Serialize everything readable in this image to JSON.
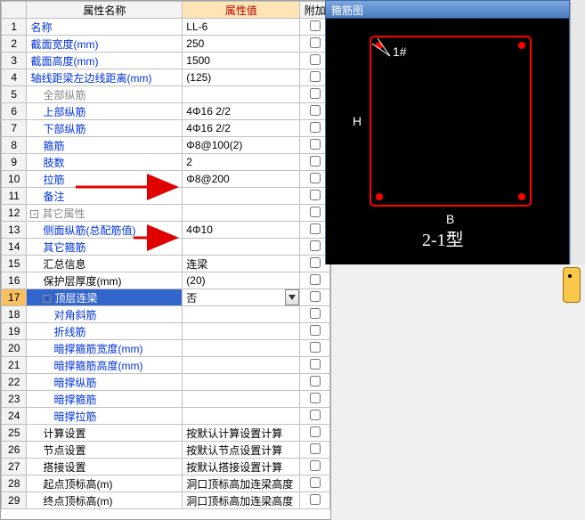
{
  "headers": {
    "name": "属性名称",
    "value": "属性值",
    "attach": "附加",
    "diagram_title": "箍筋图"
  },
  "diagram": {
    "label_1": "1#",
    "label_h": "H",
    "label_b": "B",
    "label_type": "2-1型"
  },
  "rows": [
    {
      "num": "1",
      "name": "名称",
      "val": "LL-6",
      "cls": "blue",
      "chk": false,
      "indent": 0
    },
    {
      "num": "2",
      "name": "截面宽度(mm)",
      "val": "250",
      "cls": "blue",
      "chk": true,
      "indent": 0
    },
    {
      "num": "3",
      "name": "截面高度(mm)",
      "val": "1500",
      "cls": "blue",
      "chk": true,
      "indent": 0
    },
    {
      "num": "4",
      "name": "轴线距梁左边线距离(mm)",
      "val": "(125)",
      "cls": "blue",
      "chk": true,
      "indent": 0
    },
    {
      "num": "5",
      "name": "全部纵筋",
      "val": "",
      "cls": "gray",
      "chk": true,
      "indent": 1
    },
    {
      "num": "6",
      "name": "上部纵筋",
      "val": "4Φ16 2/2",
      "cls": "blue",
      "chk": true,
      "indent": 1
    },
    {
      "num": "7",
      "name": "下部纵筋",
      "val": "4Φ16 2/2",
      "cls": "blue",
      "chk": true,
      "indent": 1
    },
    {
      "num": "8",
      "name": "箍筋",
      "val": "Φ8@100(2)",
      "cls": "blue",
      "chk": true,
      "indent": 1
    },
    {
      "num": "9",
      "name": "肢数",
      "val": "2",
      "cls": "blue",
      "chk": true,
      "indent": 1
    },
    {
      "num": "10",
      "name": "拉筋",
      "val": "Φ8@200",
      "cls": "blue",
      "chk": true,
      "indent": 1,
      "arrow": true
    },
    {
      "num": "11",
      "name": "备注",
      "val": "",
      "cls": "blue",
      "chk": true,
      "indent": 1
    },
    {
      "num": "12",
      "name": "其它属性",
      "val": "",
      "cls": "gray",
      "chk": false,
      "indent": 0,
      "toggle": "-"
    },
    {
      "num": "13",
      "name": "侧面纵筋(总配筋值)",
      "val": "4Φ10",
      "cls": "blue",
      "chk": true,
      "indent": 1,
      "arrow": true
    },
    {
      "num": "14",
      "name": "其它箍筋",
      "val": "",
      "cls": "blue",
      "chk": false,
      "indent": 1
    },
    {
      "num": "15",
      "name": "汇总信息",
      "val": "连梁",
      "cls": "",
      "chk": true,
      "indent": 1
    },
    {
      "num": "16",
      "name": "保护层厚度(mm)",
      "val": "(20)",
      "cls": "",
      "chk": true,
      "indent": 1
    },
    {
      "num": "17",
      "name": "顶层连梁",
      "val": "否",
      "cls": "",
      "chk": true,
      "indent": 1,
      "toggle": "-",
      "sel": true,
      "dd": true
    },
    {
      "num": "18",
      "name": "对角斜筋",
      "val": "",
      "cls": "blue",
      "chk": true,
      "indent": 2
    },
    {
      "num": "19",
      "name": "折线筋",
      "val": "",
      "cls": "blue",
      "chk": true,
      "indent": 2
    },
    {
      "num": "20",
      "name": "暗撑箍筋宽度(mm)",
      "val": "",
      "cls": "blue",
      "chk": true,
      "indent": 2
    },
    {
      "num": "21",
      "name": "暗撑箍筋高度(mm)",
      "val": "",
      "cls": "blue",
      "chk": true,
      "indent": 2
    },
    {
      "num": "22",
      "name": "暗撑纵筋",
      "val": "",
      "cls": "blue",
      "chk": true,
      "indent": 2
    },
    {
      "num": "23",
      "name": "暗撑箍筋",
      "val": "",
      "cls": "blue",
      "chk": true,
      "indent": 2
    },
    {
      "num": "24",
      "name": "暗撑拉筋",
      "val": "",
      "cls": "blue",
      "chk": true,
      "indent": 2
    },
    {
      "num": "25",
      "name": "计算设置",
      "val": "按默认计算设置计算",
      "cls": "",
      "chk": false,
      "indent": 1
    },
    {
      "num": "26",
      "name": "节点设置",
      "val": "按默认节点设置计算",
      "cls": "",
      "chk": false,
      "indent": 1
    },
    {
      "num": "27",
      "name": "搭接设置",
      "val": "按默认搭接设置计算",
      "cls": "",
      "chk": false,
      "indent": 1
    },
    {
      "num": "28",
      "name": "起点顶标高(m)",
      "val": "洞口顶标高加连梁高度",
      "cls": "",
      "chk": true,
      "indent": 1
    },
    {
      "num": "29",
      "name": "终点顶标高(m)",
      "val": "洞口顶标高加连梁高度",
      "cls": "",
      "chk": true,
      "indent": 1
    }
  ]
}
